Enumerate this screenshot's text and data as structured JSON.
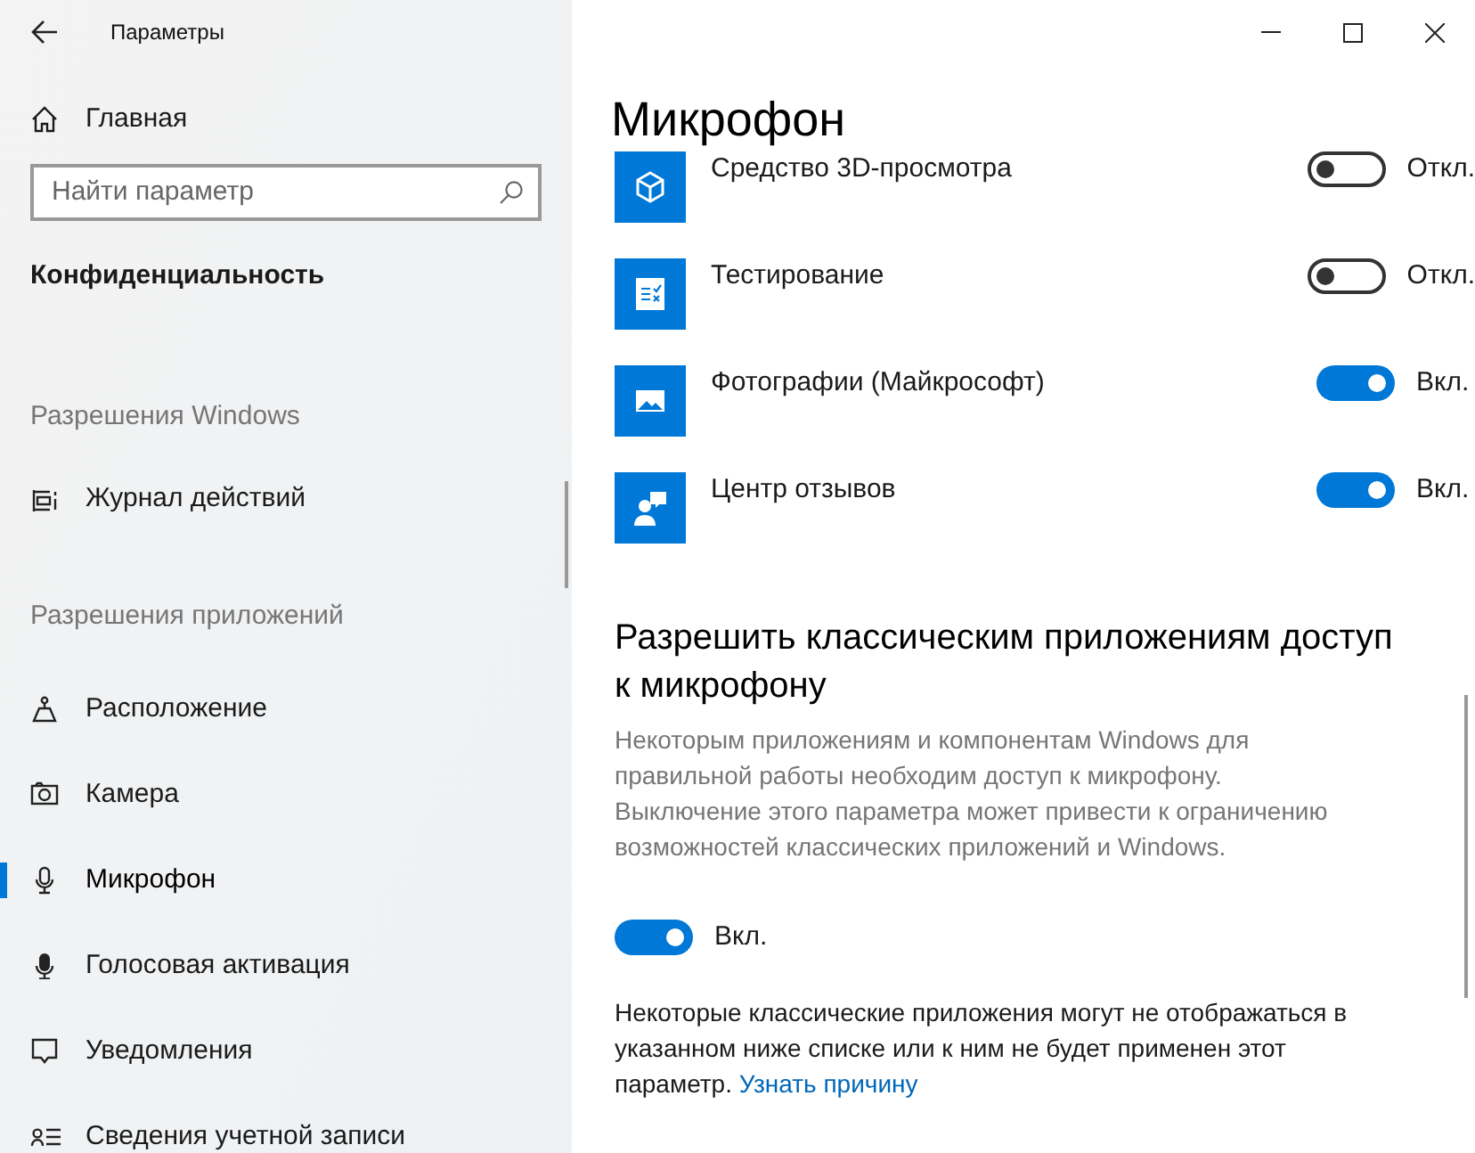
{
  "window": {
    "title": "Параметры"
  },
  "sidebar": {
    "home": "Главная",
    "search": {
      "placeholder": "Найти параметр"
    },
    "category": "Конфиденциальность",
    "groups": [
      {
        "heading": "Разрешения Windows",
        "items": [
          {
            "label": "Журнал действий",
            "selected": false
          }
        ]
      },
      {
        "heading": "Разрешения приложений",
        "items": [
          {
            "label": "Расположение",
            "selected": false
          },
          {
            "label": "Камера",
            "selected": false
          },
          {
            "label": "Микрофон",
            "selected": true
          },
          {
            "label": "Голосовая активация",
            "selected": false
          },
          {
            "label": "Уведомления",
            "selected": false
          },
          {
            "label": "Сведения учетной записи",
            "selected": false
          }
        ]
      }
    ]
  },
  "page": {
    "title": "Микрофон",
    "apps": [
      {
        "name": "Средство 3D-просмотра",
        "on": false,
        "state_label": "Откл."
      },
      {
        "name": "Тестирование",
        "on": false,
        "state_label": "Откл."
      },
      {
        "name": "Фотографии (Майкрософт)",
        "on": true,
        "state_label": "Вкл."
      },
      {
        "name": "Центр отзывов",
        "on": true,
        "state_label": "Вкл."
      }
    ],
    "classic": {
      "heading": "Разрешить классическим приложениям доступ к микрофону",
      "description": "Некоторым приложениям и компонентам Windows для правильной работы необходим доступ к микрофону. Выключение этого параметра может привести к ограничению возможностей классических приложений и Windows.",
      "on": true,
      "state_label": "Вкл.",
      "note": "Некоторые классические приложения могут не отображаться в указанном ниже списке или к ним не будет применен этот параметр.",
      "link": "Узнать причину"
    }
  }
}
